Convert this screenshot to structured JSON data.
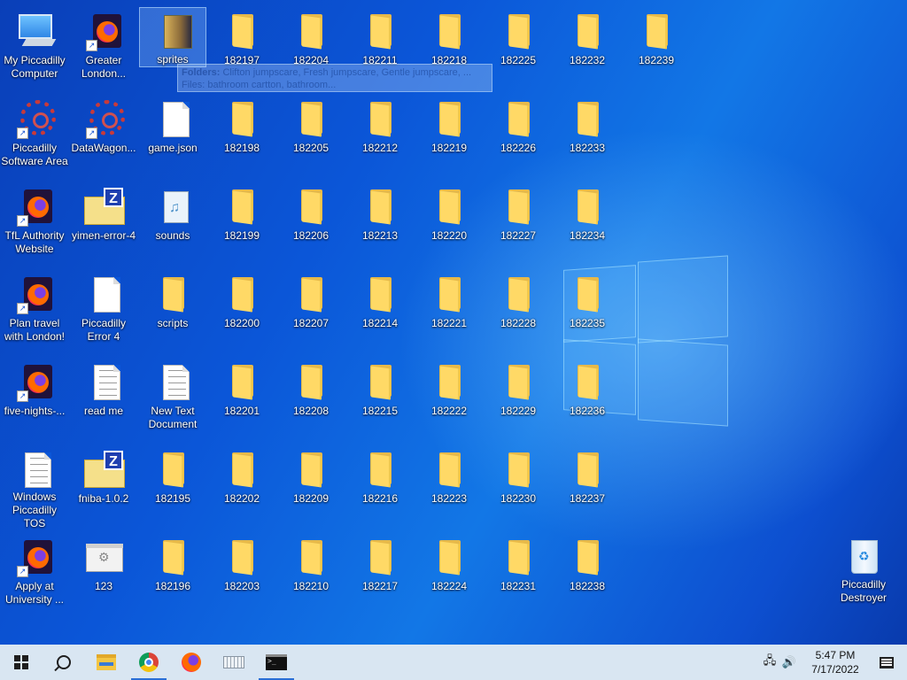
{
  "desktop": {
    "col1": [
      "My Piccadilly Computer",
      "Piccadilly Software Area",
      "TfL Authority Website",
      "Plan travel with London!",
      "five-nights-...",
      "Windows Piccadilly TOS",
      "Apply at University ..."
    ],
    "col2": [
      "Greater London...",
      "DataWagon...",
      "yimen-error-4",
      "Piccadilly Error 4",
      "read me",
      "fniba-1.0.2",
      "123"
    ],
    "col3": [
      "sprites",
      "game.json",
      "sounds",
      "scripts",
      "New Text Document",
      "182195",
      "182196"
    ],
    "folders": {
      "c4": [
        "182197",
        "182198",
        "182199",
        "182200",
        "182201",
        "182202",
        "182203"
      ],
      "c5": [
        "182204",
        "182205",
        "182206",
        "182207",
        "182208",
        "182209",
        "182210"
      ],
      "c6": [
        "182211",
        "182212",
        "182213",
        "182214",
        "182215",
        "182216",
        "182217"
      ],
      "c7": [
        "182218",
        "182219",
        "182220",
        "182221",
        "182222",
        "182223",
        "182224"
      ],
      "c8": [
        "182225",
        "182226",
        "182227",
        "182228",
        "182229",
        "182230",
        "182231"
      ],
      "c9": [
        "182232",
        "182233",
        "182234",
        "182235",
        "182236",
        "182237",
        "182238"
      ],
      "c10": [
        "182239"
      ]
    },
    "recycle_bin": "Piccadilly Destroyer"
  },
  "tooltip": {
    "line1_label": "Folders:",
    "line1": "Clifton jumpscare, Fresh jumpscare, Gentle jumpscare, ...",
    "line2_label": "Files:",
    "line2": "bathroom cartton, bathroom..."
  },
  "taskbar": {
    "time": "5:47 PM",
    "date": "7/17/2022"
  },
  "icons": {
    "start": "windows-start-icon",
    "search": "search-icon",
    "explorer": "file-explorer-icon",
    "chrome": "chrome-icon",
    "firefox": "firefox-icon",
    "keyboard": "keyboard-icon",
    "cmd": "command-prompt-icon",
    "network": "network-icon",
    "volume": "volume-icon",
    "notifications": "notifications-icon"
  }
}
